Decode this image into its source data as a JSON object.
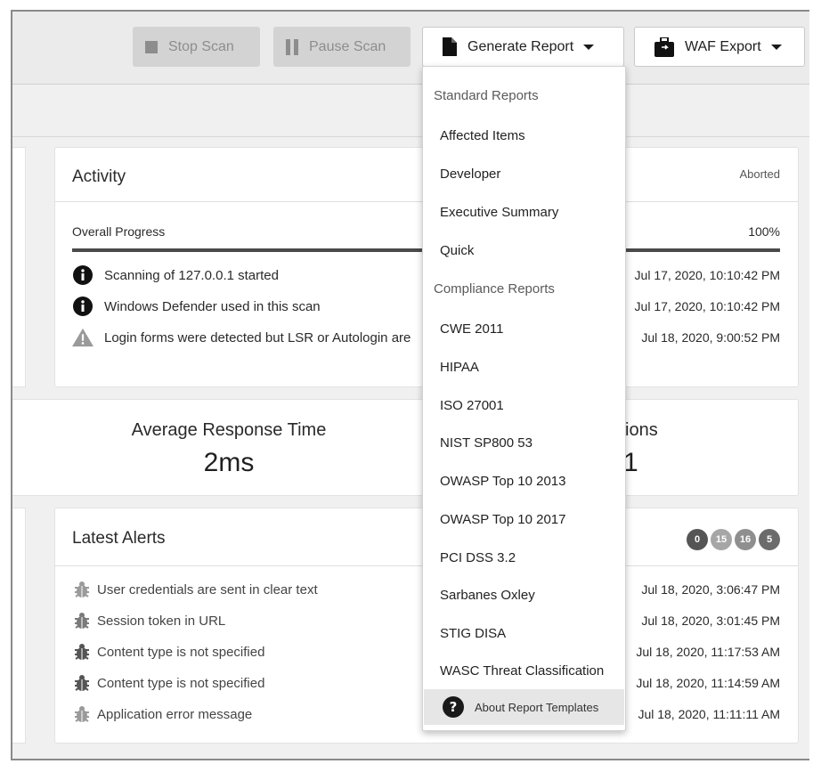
{
  "toolbar": {
    "stop_label": "Stop Scan",
    "pause_label": "Pause Scan",
    "report_label": "Generate Report",
    "waf_label": "WAF Export"
  },
  "activity": {
    "title": "Activity",
    "status": "Aborted",
    "progress_label": "Overall Progress",
    "progress_value": "100%",
    "progress_fraction": 1.0,
    "events": [
      {
        "icon": "info-icon",
        "text": "Scanning of 127.0.0.1 started",
        "time": "Jul 17, 2020, 10:10:42 PM"
      },
      {
        "icon": "info-icon",
        "text": "Windows Defender used in this scan",
        "time": "Jul 17, 2020, 10:10:42 PM"
      },
      {
        "icon": "warning-icon",
        "text": "Login forms were detected but LSR or Autologin are",
        "time": "Jul 18, 2020, 9:00:52 PM"
      }
    ]
  },
  "stats": {
    "response_label": "Average Response Time",
    "response_value": "2ms",
    "right_label_fragment": "ions",
    "right_value_fragment": "1"
  },
  "alerts": {
    "title": "Latest Alerts",
    "counts": [
      {
        "value": "0",
        "color": "#555555"
      },
      {
        "value": "15",
        "color": "#a6a6a6"
      },
      {
        "value": "16",
        "color": "#8f8f8f"
      },
      {
        "value": "5",
        "color": "#6b6b6b"
      }
    ],
    "items": [
      {
        "text": "User credentials are sent in clear text",
        "time": "Jul 18, 2020, 3:06:47 PM",
        "color": "#9a9a9a"
      },
      {
        "text": "Session token in URL",
        "time": "Jul 18, 2020, 3:01:45 PM",
        "color": "#7a7a7a"
      },
      {
        "text": "Content type is not specified",
        "time": "Jul 18, 2020, 11:17:53 AM",
        "color": "#555555"
      },
      {
        "text": "Content type is not specified",
        "time": "Jul 18, 2020, 11:14:59 AM",
        "color": "#555555"
      },
      {
        "text": "Application error message",
        "time": "Jul 18, 2020, 11:11:11 AM",
        "color": "#9a9a9a"
      }
    ]
  },
  "report_menu": {
    "standard_header": "Standard Reports",
    "standard_items": [
      "Affected Items",
      "Developer",
      "Executive Summary",
      "Quick"
    ],
    "compliance_header": "Compliance Reports",
    "compliance_items": [
      "CWE 2011",
      "HIPAA",
      "ISO 27001",
      "NIST SP800 53",
      "OWASP Top 10 2013",
      "OWASP Top 10 2017",
      "PCI DSS 3.2",
      "Sarbanes Oxley",
      "STIG DISA",
      "WASC Threat Classification"
    ],
    "footer_label": "About Report Templates"
  }
}
